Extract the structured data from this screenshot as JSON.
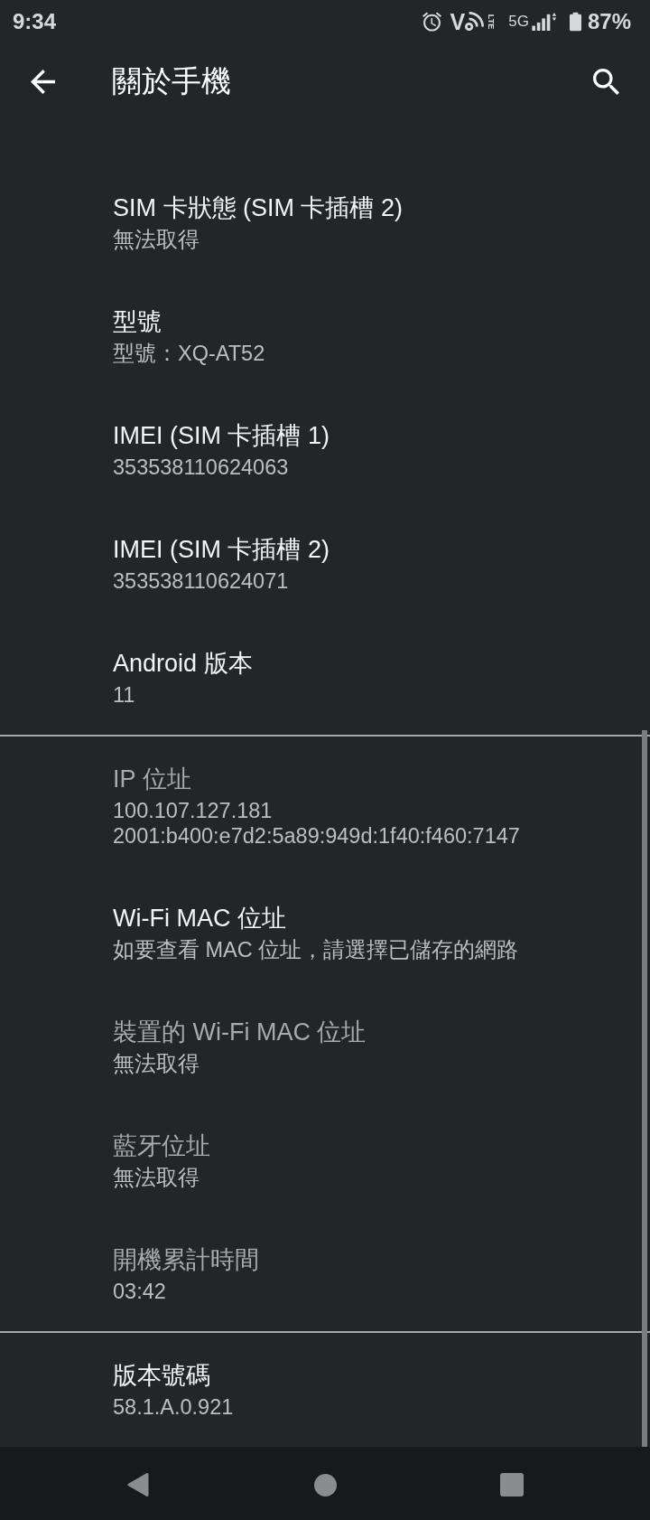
{
  "status_bar": {
    "time": "9:34",
    "volte_letter": "V",
    "volte_tech": "LTE",
    "network": "5G",
    "battery": "87%"
  },
  "app_bar": {
    "title": "關於手機"
  },
  "sections": [
    {
      "items": [
        {
          "title": "SIM 卡狀態 (SIM 卡插槽 2)",
          "summary": [
            "無法取得"
          ],
          "disabled": false
        },
        {
          "title": "型號",
          "summary": [
            "型號：XQ-AT52"
          ],
          "disabled": false
        },
        {
          "title": "IMEI (SIM 卡插槽 1)",
          "summary": [
            "353538110624063"
          ],
          "disabled": false
        },
        {
          "title": "IMEI (SIM 卡插槽 2)",
          "summary": [
            "353538110624071"
          ],
          "disabled": false
        },
        {
          "title": "Android 版本",
          "summary": [
            "11"
          ],
          "disabled": false
        }
      ]
    },
    {
      "items": [
        {
          "title": "IP 位址",
          "summary": [
            "100.107.127.181",
            "2001:b400:e7d2:5a89:949d:1f40:f460:7147"
          ],
          "disabled": true
        },
        {
          "title": "Wi-Fi MAC 位址",
          "summary": [
            "如要查看 MAC 位址，請選擇已儲存的網路"
          ],
          "disabled": false
        },
        {
          "title": "裝置的 Wi-Fi MAC 位址",
          "summary": [
            "無法取得"
          ],
          "disabled": true
        },
        {
          "title": "藍牙位址",
          "summary": [
            "無法取得"
          ],
          "disabled": true
        },
        {
          "title": "開機累計時間",
          "summary": [
            "03:42"
          ],
          "disabled": true
        }
      ]
    },
    {
      "items": [
        {
          "title": "版本號碼",
          "summary": [
            "58.1.A.0.921"
          ],
          "disabled": false
        }
      ]
    }
  ]
}
